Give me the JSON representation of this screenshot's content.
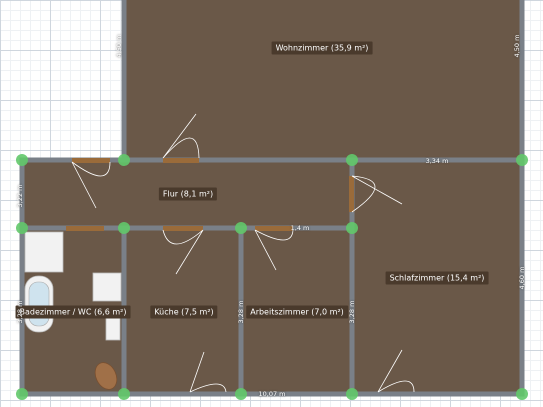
{
  "colors": {
    "floor": "#6a5848",
    "wall": "#7a8088",
    "node": "#62c86a",
    "door": "#9a6b3a",
    "fixture": "#f2f2f2",
    "grid": "#cfd6de"
  },
  "rooms": [
    {
      "key": "wohnzimmer",
      "label": "Wohnzimmer (35,9 m²)"
    },
    {
      "key": "flur",
      "label": "Flur (8,1 m²)"
    },
    {
      "key": "schlafzimmer",
      "label": "Schlafzimmer (15,4 m²)"
    },
    {
      "key": "badezimmer",
      "label": "Badezimmer / WC (6,6 m²)"
    },
    {
      "key": "kueche",
      "label": "Küche (7,5 m²)"
    },
    {
      "key": "arbeitszimmer",
      "label": "Arbeitszimmer (7,0 m²)"
    }
  ],
  "dimensions": {
    "wohn_left": "4,50 m",
    "wohn_right": "4,50 m",
    "hall_right": "3,34 m",
    "flur_left": "3,22 m",
    "mid_horizontal": "1,4 m",
    "schlaf_right": "4,60 m",
    "bad_left": "3,28 m",
    "kueche_wall": "3,28 m",
    "arbeit_wall": "3,28 m",
    "bottom_total": "10,07 m"
  },
  "icons": {
    "node": "wall-corner-handle-icon",
    "door": "door-swing-icon",
    "bathtub": "bathtub-icon",
    "shower": "shower-tray-icon",
    "toilet": "toilet-icon",
    "sink": "sink-icon"
  }
}
